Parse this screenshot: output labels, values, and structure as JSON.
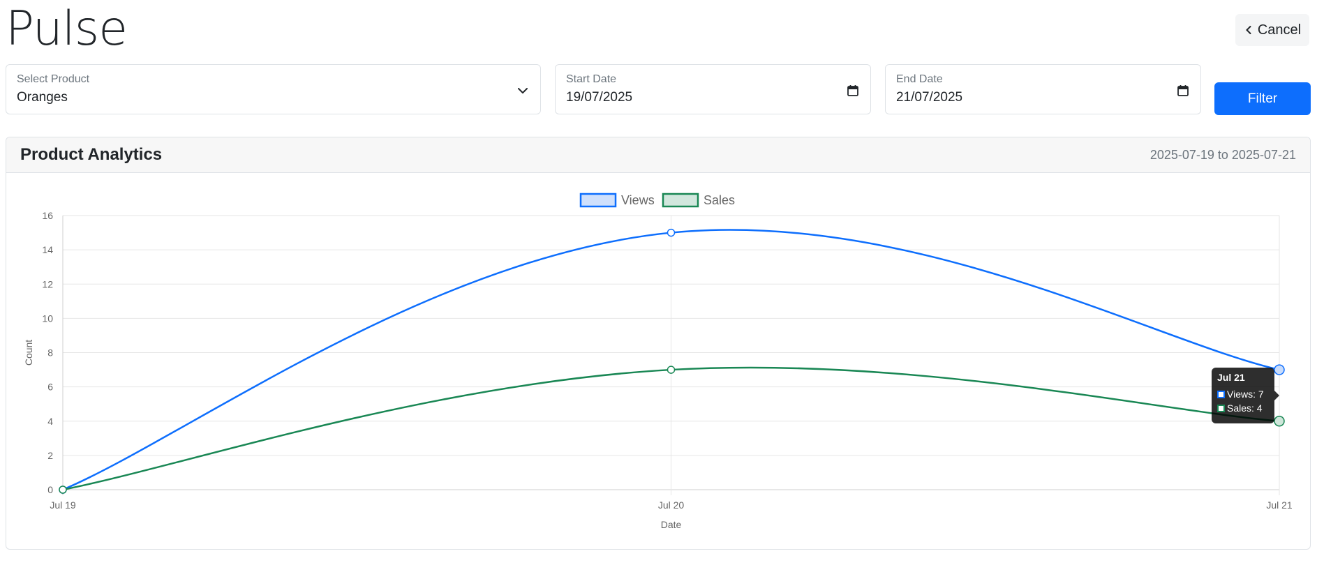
{
  "header": {
    "title": "Pulse",
    "cancel_label": "Cancel"
  },
  "filters": {
    "product": {
      "label": "Select Product",
      "value": "Oranges"
    },
    "start_date": {
      "label": "Start Date",
      "value": "19/07/2025"
    },
    "end_date": {
      "label": "End Date",
      "value": "21/07/2025"
    },
    "filter_label": "Filter"
  },
  "card": {
    "title": "Product Analytics",
    "range": "2025-07-19 to 2025-07-21"
  },
  "icons": {
    "cancel": "chevron-left-icon",
    "product": "chevron-down-icon",
    "date": "calendar-icon"
  },
  "colors": {
    "views": "#0d6efd",
    "sales": "#198754",
    "primary": "#0d6efd"
  },
  "tooltip": {
    "title": "Jul 21",
    "rows": [
      {
        "label": "Views: 7"
      },
      {
        "label": "Sales: 4"
      }
    ]
  },
  "chart_data": {
    "type": "line",
    "categories": [
      "Jul 19",
      "Jul 20",
      "Jul 21"
    ],
    "series": [
      {
        "name": "Views",
        "values": [
          0,
          15,
          7
        ],
        "color": "#0d6efd"
      },
      {
        "name": "Sales",
        "values": [
          0,
          7,
          4
        ],
        "color": "#198754"
      }
    ],
    "xlabel": "Date",
    "ylabel": "Count",
    "ylim": [
      0,
      16
    ],
    "yticks": [
      0,
      2,
      4,
      6,
      8,
      10,
      12,
      14,
      16
    ],
    "legend": "top-center",
    "grid": true,
    "curve": "smooth"
  }
}
